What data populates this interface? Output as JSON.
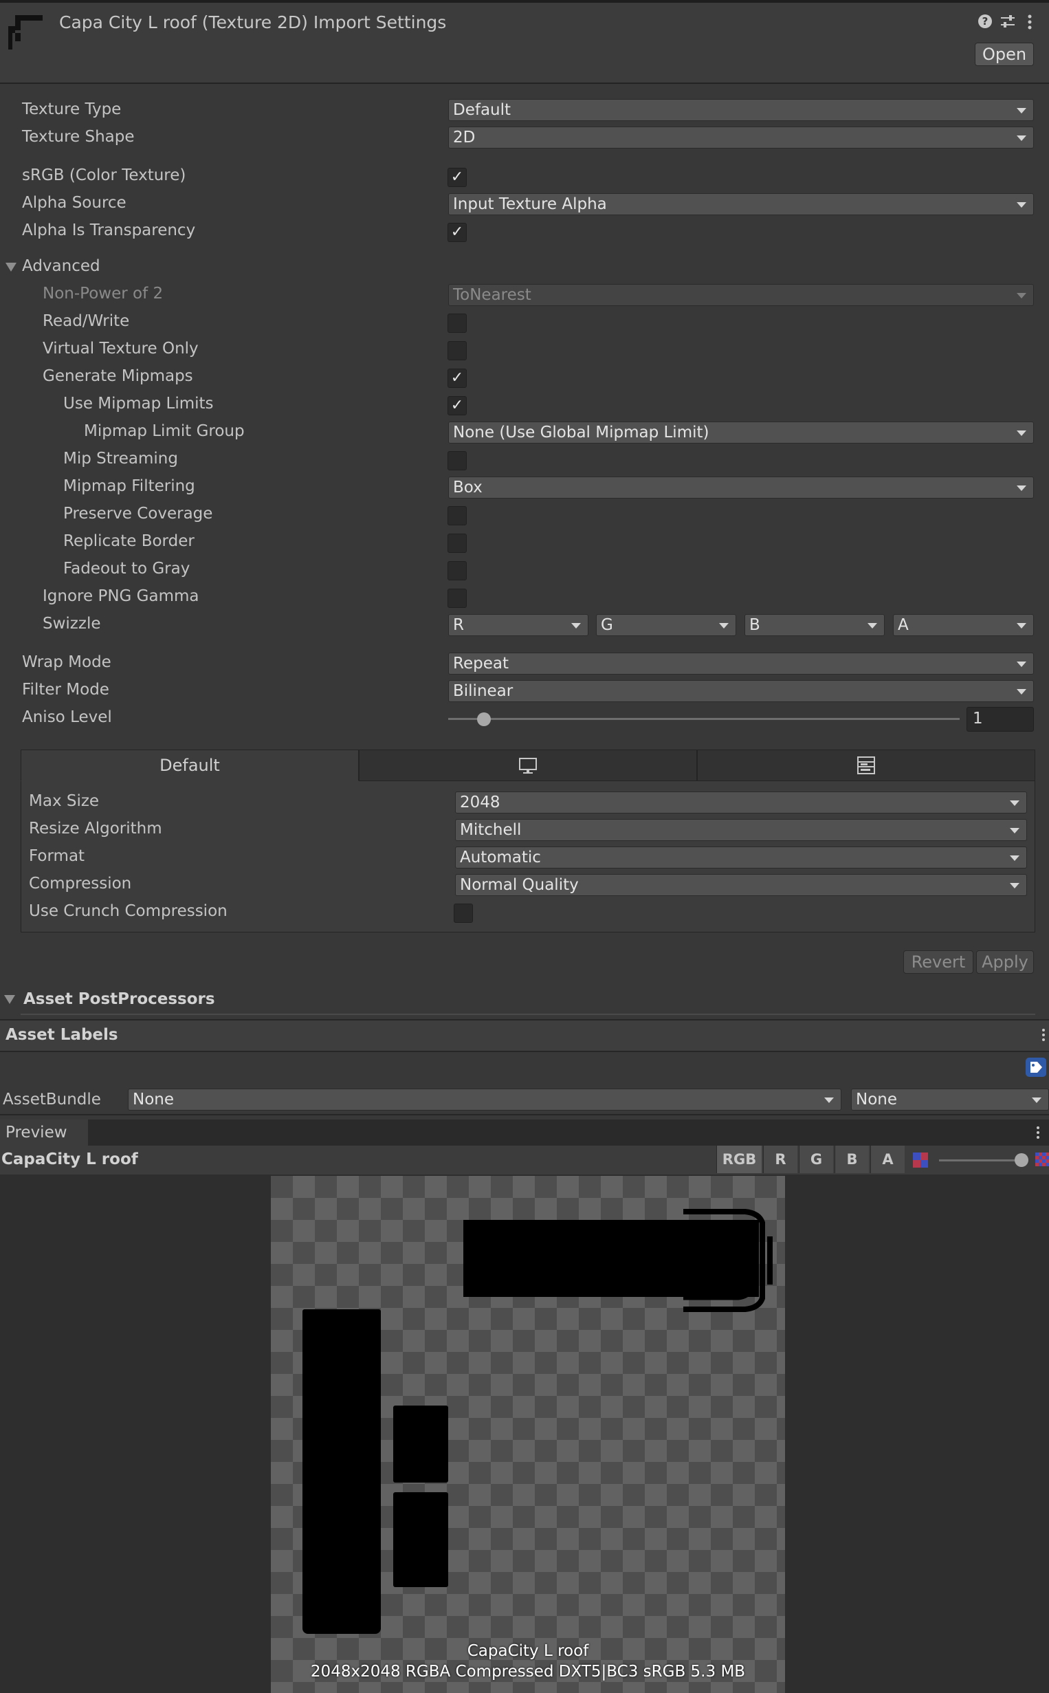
{
  "header": {
    "title": "Capa City L roof (Texture 2D) Import Settings",
    "open_label": "Open",
    "help_icon": "help-icon",
    "preset_icon": "preset-sliders-icon",
    "menu_icon": "kebab-menu-icon"
  },
  "settings": {
    "texture_type": {
      "label": "Texture Type",
      "value": "Default"
    },
    "texture_shape": {
      "label": "Texture Shape",
      "value": "2D"
    },
    "srgb": {
      "label": "sRGB (Color Texture)",
      "checked": true
    },
    "alpha_source": {
      "label": "Alpha Source",
      "value": "Input Texture Alpha"
    },
    "alpha_is_transparency": {
      "label": "Alpha Is Transparency",
      "checked": true
    }
  },
  "advanced": {
    "label": "Advanced",
    "non_power_of_2": {
      "label": "Non-Power of 2",
      "value": "ToNearest"
    },
    "read_write": {
      "label": "Read/Write",
      "checked": false
    },
    "virtual_texture_only": {
      "label": "Virtual Texture Only",
      "checked": false
    },
    "generate_mipmaps": {
      "label": "Generate Mipmaps",
      "checked": true
    },
    "use_mipmap_limits": {
      "label": "Use Mipmap Limits",
      "checked": true
    },
    "mipmap_limit_group": {
      "label": "Mipmap Limit Group",
      "value": "None (Use Global Mipmap Limit)"
    },
    "mip_streaming": {
      "label": "Mip Streaming",
      "checked": false
    },
    "mipmap_filtering": {
      "label": "Mipmap Filtering",
      "value": "Box"
    },
    "preserve_coverage": {
      "label": "Preserve Coverage",
      "checked": false
    },
    "replicate_border": {
      "label": "Replicate Border",
      "checked": false
    },
    "fadeout_to_gray": {
      "label": "Fadeout to Gray",
      "checked": false
    },
    "ignore_png_gamma": {
      "label": "Ignore PNG Gamma",
      "checked": false
    },
    "swizzle": {
      "label": "Swizzle",
      "r": "R",
      "g": "G",
      "b": "B",
      "a": "A"
    }
  },
  "wrap": {
    "wrap_mode": {
      "label": "Wrap Mode",
      "value": "Repeat"
    },
    "filter_mode": {
      "label": "Filter Mode",
      "value": "Bilinear"
    },
    "aniso_level": {
      "label": "Aniso Level",
      "value": "1",
      "slider_fraction": 0.07
    }
  },
  "platform": {
    "tabs": [
      {
        "label": "Default"
      },
      {
        "icon": "monitor-icon"
      },
      {
        "icon": "web-platform-icon"
      }
    ],
    "max_size": {
      "label": "Max Size",
      "value": "2048"
    },
    "resize_algorithm": {
      "label": "Resize Algorithm",
      "value": "Mitchell"
    },
    "format": {
      "label": "Format",
      "value": "Automatic"
    },
    "compression": {
      "label": "Compression",
      "value": "Normal Quality"
    },
    "use_crunch": {
      "label": "Use Crunch Compression",
      "checked": false
    }
  },
  "actions": {
    "revert": "Revert",
    "apply": "Apply"
  },
  "postprocessors": {
    "label": "Asset PostProcessors"
  },
  "labels": {
    "label": "Asset Labels",
    "tag_icon": "tag-icon"
  },
  "assetbundle": {
    "label": "AssetBundle",
    "name": "None",
    "variant": "None"
  },
  "preview": {
    "tab": "Preview",
    "asset_name": "CapaCity L roof",
    "channels": [
      "RGB",
      "R",
      "G",
      "B",
      "A"
    ],
    "mip_slider_fraction": 1.0,
    "caption_name": "CapaCity L roof",
    "caption_info": "2048x2048  RGBA Compressed DXT5|BC3 sRGB   5.3 MB"
  }
}
